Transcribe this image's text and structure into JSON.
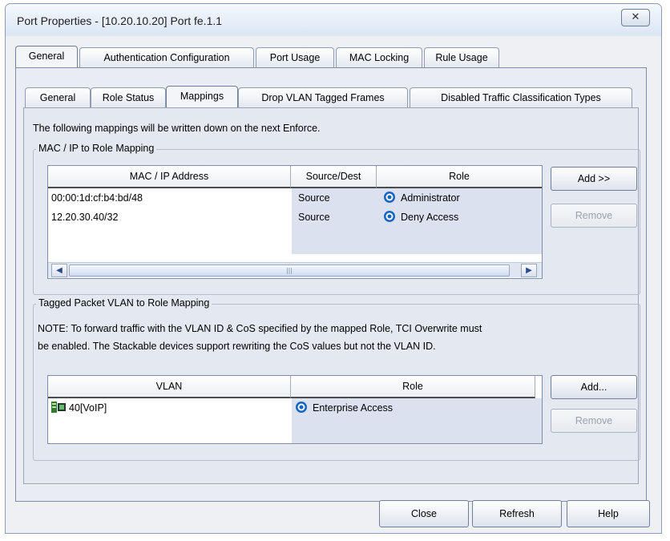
{
  "window": {
    "title": "Port Properties - [10.20.10.20] Port fe.1.1",
    "close_glyph": "✕"
  },
  "main_tabs": [
    "General",
    "Authentication Configuration",
    "Port Usage",
    "MAC Locking",
    "Rule Usage"
  ],
  "sub_tabs": [
    "General",
    "Role Status",
    "Mappings",
    "Drop VLAN Tagged Frames",
    "Disabled Traffic Classification Types"
  ],
  "info_text": "The following mappings will be written down on the next Enforce.",
  "mac_group": {
    "label": "MAC / IP to Role Mapping",
    "columns": [
      "MAC / IP Address",
      "Source/Dest",
      "Role"
    ],
    "rows": [
      {
        "address": "00:00:1d:cf:b4:bd/48",
        "source": "Source",
        "role": "Administrator",
        "icon": "role-icon"
      },
      {
        "address": "12.20.30.40/32",
        "source": "Source",
        "role": "Deny Access",
        "icon": "role-icon"
      }
    ],
    "add_label": "Add >>",
    "remove_label": "Remove"
  },
  "vlan_group": {
    "label": "Tagged Packet VLAN to Role Mapping",
    "note_line1": "NOTE: To forward traffic with the VLAN ID & CoS specified by the mapped Role, TCI Overwrite must",
    "note_line2": "be enabled. The Stackable devices support rewriting the CoS values but not the VLAN ID.",
    "columns": [
      "VLAN",
      "Role"
    ],
    "rows": [
      {
        "vlan": "40[VoIP]",
        "role": "Enterprise Access",
        "vlan_icon": "vlan-icon",
        "role_icon": "role-icon"
      }
    ],
    "add_label": "Add...",
    "remove_label": "Remove"
  },
  "footer": {
    "close_label": "Close",
    "refresh_label": "Refresh",
    "help_label": "Help"
  },
  "colors": {
    "accent": "#1565c0",
    "table_shade": "#dbe1ee"
  }
}
